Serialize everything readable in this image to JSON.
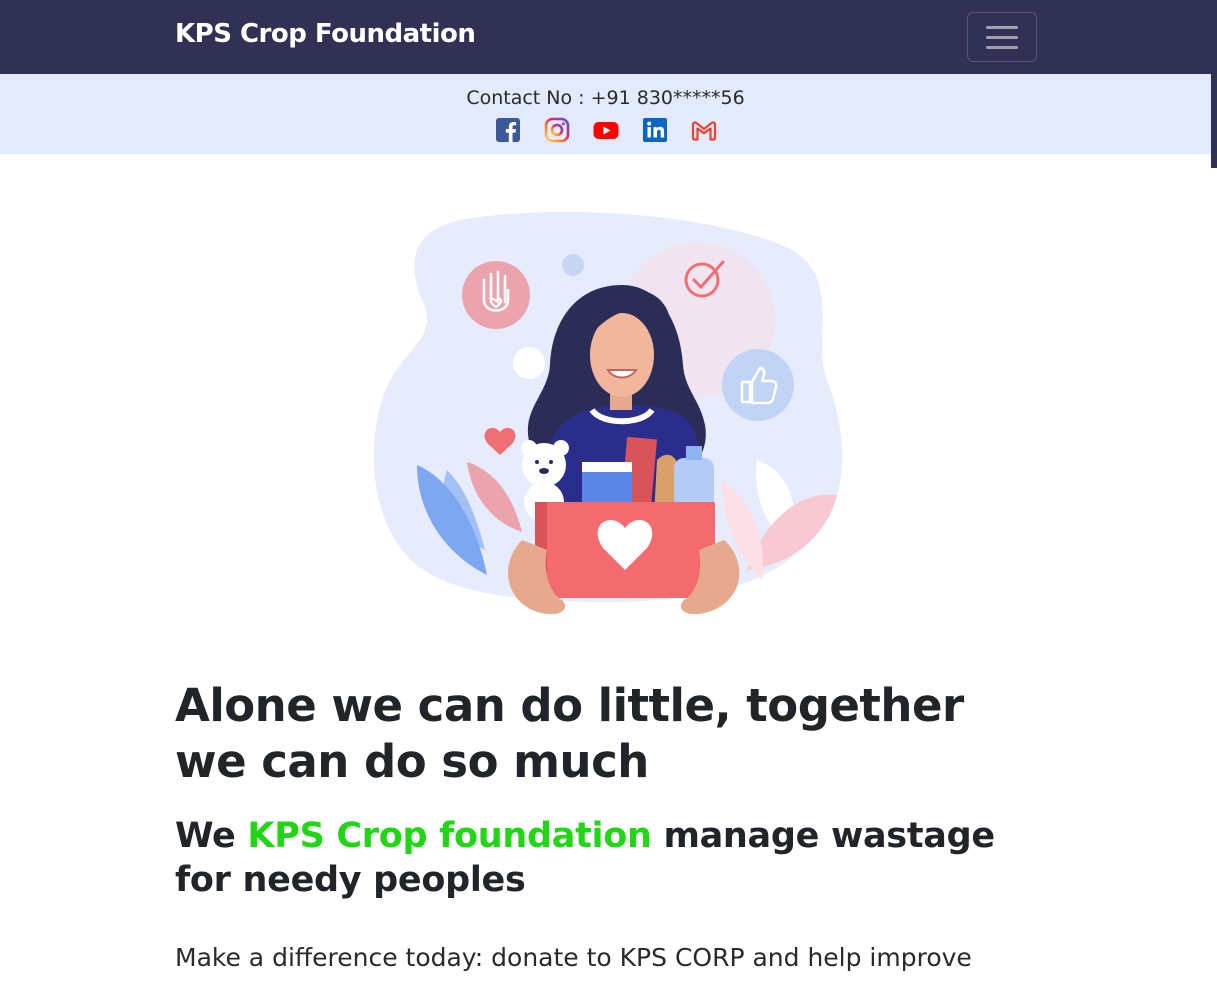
{
  "navbar": {
    "brand": "KPS Crop Foundation",
    "toggler_icon": "hamburger-menu-icon",
    "bg_color": "#313055"
  },
  "contact_bar": {
    "contact_text": "Contact No : +91 830*****56",
    "bg_color": "#e3eafc",
    "socials": [
      {
        "icon": "facebook-icon",
        "color": "#3b5998"
      },
      {
        "icon": "instagram-icon",
        "color": "#d62976"
      },
      {
        "icon": "youtube-icon",
        "color": "#ff0000"
      },
      {
        "icon": "linkedin-icon",
        "color": "#0a66c2"
      },
      {
        "icon": "gmail-icon",
        "color": "#ea4335"
      }
    ]
  },
  "hero": {
    "illustration": "woman-holding-donation-box-illustration"
  },
  "content": {
    "headline": "Alone we can do little, together we can do so much",
    "subhead_prefix": "We ",
    "subhead_accent": "KPS Crop foundation",
    "subhead_suffix": " manage wastage for needy peoples",
    "accent_color": "#21d614",
    "body": "Make a difference today: donate to KPS CORP and help improve"
  }
}
